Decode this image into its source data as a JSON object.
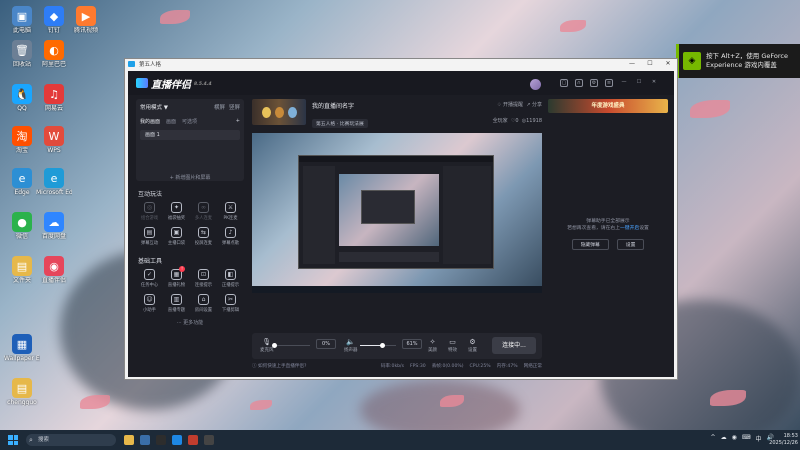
{
  "desktop": {
    "icons": [
      {
        "label": "此电脑",
        "color": "#4a86c8",
        "glyph": "▣"
      },
      {
        "label": "钉钉",
        "color": "#2e7df6",
        "glyph": "◆"
      },
      {
        "label": "腾讯视频",
        "color": "#ff7a2f",
        "glyph": "▶"
      },
      {
        "label": "回收站",
        "color": "#6c7f95",
        "glyph": "🗑"
      },
      {
        "label": "阿里巴巴",
        "color": "#ff6a00",
        "glyph": "◐"
      },
      {
        "label": "QQ",
        "color": "#1aa6ff",
        "glyph": "🐧"
      },
      {
        "label": "网易云",
        "color": "#e33a3a",
        "glyph": "♫"
      },
      {
        "label": "淘宝",
        "color": "#ff5000",
        "glyph": "淘"
      },
      {
        "label": "WPS",
        "color": "#e24b3c",
        "glyph": "W"
      },
      {
        "label": "Edge",
        "color": "#2d8fd4",
        "glyph": "e"
      },
      {
        "label": "Microsoft Edge",
        "color": "#1f9bd7",
        "glyph": "e"
      },
      {
        "label": "百度网盘",
        "color": "#2f86ff",
        "glyph": "☁"
      },
      {
        "label": "微信",
        "color": "#2bb24c",
        "glyph": "●"
      },
      {
        "label": "文件夹",
        "color": "#e6b84a",
        "glyph": "▤"
      },
      {
        "label": "直播伴侣",
        "color": "#e6465b",
        "glyph": "◉"
      },
      {
        "label": "Wallpaper Engine",
        "color": "#1e5fb8",
        "glyph": "▦"
      },
      {
        "label": "chengguo",
        "color": "#e6b84a",
        "glyph": "▤"
      }
    ]
  },
  "toast": {
    "text": "按下 Alt+Z，使用 GeForce Experience 游戏内覆盖"
  },
  "outer_window": {
    "title": "第五人格"
  },
  "app": {
    "logo": "直播伴侣",
    "version": "8.5.4.4",
    "toolbar_icons": [
      "message-icon",
      "headset-icon",
      "settings-icon",
      "menu-icon",
      "minimize-icon",
      "maximize-icon",
      "close-icon"
    ],
    "left": {
      "mode_label": "常用模式 ▼",
      "mode_actions": [
        "横屏",
        "竖屏"
      ],
      "scene_tabs": [
        "我的画面",
        "画面",
        "可选项"
      ],
      "scene_item": "画面 1",
      "add_source": "+ 新增图片和屏幕",
      "interactive_title": "互动玩法",
      "interactive_tools": [
        {
          "name": "组合游戏",
          "icon": "gamepad-icon",
          "dim": true
        },
        {
          "name": "福袋抽奖",
          "icon": "gift-icon",
          "dim": false
        },
        {
          "name": "多人连麦",
          "icon": "link-icon",
          "dim": true
        },
        {
          "name": "PK连麦",
          "icon": "pk-icon",
          "dim": false
        },
        {
          "name": "弹幕互动",
          "icon": "chat-icon",
          "dim": false
        },
        {
          "name": "主播口袋",
          "icon": "wallet-icon",
          "dim": false
        },
        {
          "name": "投屏连麦",
          "icon": "cast-icon",
          "dim": false
        },
        {
          "name": "弹幕点歌",
          "icon": "music-icon",
          "dim": false
        }
      ],
      "basic_title": "基础工具",
      "basic_tools": [
        {
          "name": "任务中心",
          "icon": "task-icon",
          "badge": ""
        },
        {
          "name": "直播礼物",
          "icon": "gift-box-icon",
          "badge": "!"
        },
        {
          "name": "连接提示",
          "icon": "link-tip-icon",
          "badge": ""
        },
        {
          "name": "正播提示",
          "icon": "live-tip-icon",
          "badge": ""
        },
        {
          "name": "小助手",
          "icon": "helper-icon",
          "badge": ""
        },
        {
          "name": "直播专题",
          "icon": "topic-icon",
          "badge": ""
        },
        {
          "name": "房间设置",
          "icon": "room-icon",
          "badge": ""
        },
        {
          "name": "下播剪辑",
          "icon": "clip-icon",
          "badge": ""
        }
      ],
      "more": "··· 更多功能"
    },
    "center": {
      "room_title": "我的直播间名字",
      "room_category": "第五人格 · 比赛玩法展",
      "room_actions": [
        "开播提醒",
        "分享"
      ],
      "room_stats": [
        "全玩家",
        "0",
        "11918"
      ],
      "controls": {
        "mic_label": "麦克风",
        "mic_percent": "0%",
        "speaker_label": "扬声器",
        "speaker_percent": "61%",
        "mic_level": 0,
        "speaker_level": 61,
        "beauty_label": "美颜",
        "effects_label": "特效",
        "settings_label": "设置",
        "go_live": "连接中..."
      },
      "status_left": "ⓘ 如何快速上手直播伴侣?",
      "status_right": [
        "码率:0kb/s",
        "FPS:30",
        "丢帧:0(0.00%)",
        "CPU:25%",
        "内存:47%",
        "网络正常"
      ]
    },
    "right": {
      "banner": "年度游戏盛典",
      "message_line1": "弹幕助手已全部展示",
      "message_line2_pre": "若想再次查看，请在右上",
      "message_link": "一键开启",
      "message_line2_post": "设置",
      "buttons": [
        "隐藏弹幕",
        "设置"
      ]
    }
  },
  "taskbar": {
    "search_placeholder": "搜索",
    "apps": [
      "#e8b84a",
      "#3a6ea8",
      "#2d2d2d",
      "#1e88e5",
      "#c13d2e",
      "#444"
    ],
    "tray": [
      "^",
      "☁",
      "◉",
      "⌨",
      "中",
      "🔊"
    ],
    "time": "18:53",
    "date": "2025/12/26"
  }
}
